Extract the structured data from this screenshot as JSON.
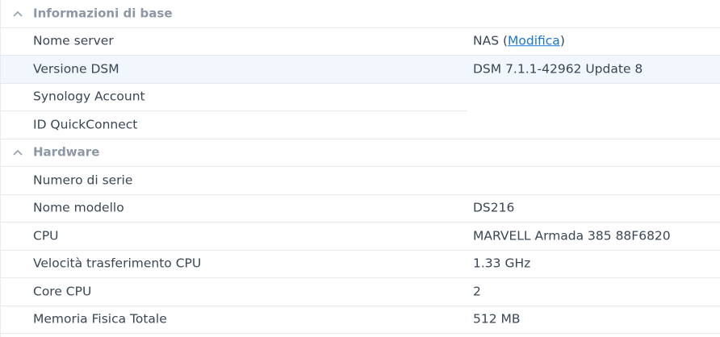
{
  "sections": {
    "basic": {
      "title": "Informazioni di base",
      "rows": {
        "server_name": {
          "label": "Nome server",
          "value_prefix": "NAS (",
          "link": "Modifica",
          "value_suffix": ")"
        },
        "dsm_version": {
          "label": "Versione DSM",
          "value": "DSM 7.1.1-42962 Update 8"
        },
        "synology_account": {
          "label": "Synology Account",
          "value": ""
        },
        "quickconnect_id": {
          "label": "ID QuickConnect",
          "value": ""
        }
      }
    },
    "hardware": {
      "title": "Hardware",
      "rows": {
        "serial_number": {
          "label": "Numero di serie",
          "value": ""
        },
        "model_name": {
          "label": "Nome modello",
          "value": "DS216"
        },
        "cpu": {
          "label": "CPU",
          "value": "MARVELL Armada 385 88F6820"
        },
        "cpu_clock": {
          "label": "Velocità trasferimento CPU",
          "value": "1.33 GHz"
        },
        "cpu_cores": {
          "label": "Core CPU",
          "value": "2"
        },
        "memory": {
          "label": "Memoria Fisica Totale",
          "value": "512 MB"
        }
      }
    }
  },
  "icons": {
    "section_toggle": "chevron-up-icon"
  },
  "colors": {
    "link": "#1a76d2",
    "selected_row": "#f1f7fd",
    "section_title": "#8d97a5",
    "text": "#3b4655"
  }
}
